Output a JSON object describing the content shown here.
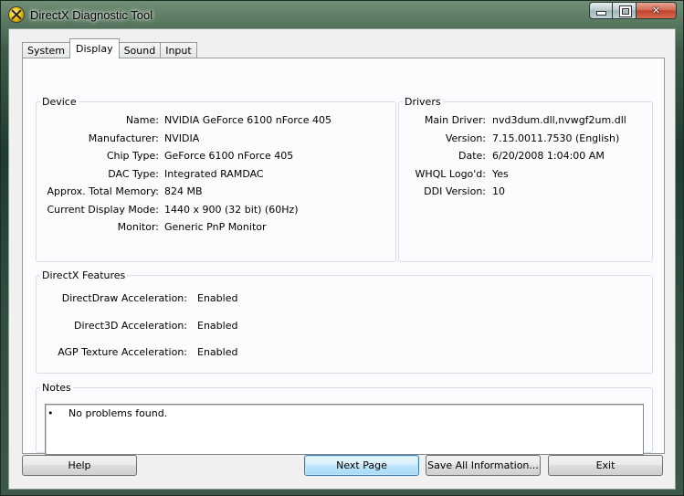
{
  "window": {
    "title": "DirectX Diagnostic Tool"
  },
  "tabs": [
    {
      "label": "System",
      "active": false
    },
    {
      "label": "Display",
      "active": true
    },
    {
      "label": "Sound",
      "active": false
    },
    {
      "label": "Input",
      "active": false
    }
  ],
  "device": {
    "legend": "Device",
    "fields": [
      {
        "label": "Name:",
        "value": "NVIDIA GeForce 6100 nForce 405"
      },
      {
        "label": "Manufacturer:",
        "value": "NVIDIA"
      },
      {
        "label": "Chip Type:",
        "value": "GeForce 6100 nForce 405"
      },
      {
        "label": "DAC Type:",
        "value": "Integrated RAMDAC"
      },
      {
        "label": "Approx. Total Memory:",
        "value": "824 MB"
      },
      {
        "label": "Current Display Mode:",
        "value": "1440 x 900 (32 bit) (60Hz)"
      },
      {
        "label": "Monitor:",
        "value": "Generic PnP Monitor"
      }
    ]
  },
  "drivers": {
    "legend": "Drivers",
    "fields": [
      {
        "label": "Main Driver:",
        "value": "nvd3dum.dll,nvwgf2um.dll"
      },
      {
        "label": "Version:",
        "value": "7.15.0011.7530 (English)"
      },
      {
        "label": "Date:",
        "value": "6/20/2008 1:04:00 AM"
      },
      {
        "label": "WHQL Logo'd:",
        "value": "Yes"
      },
      {
        "label": "DDI Version:",
        "value": "10"
      }
    ]
  },
  "features": {
    "legend": "DirectX Features",
    "fields": [
      {
        "label": "DirectDraw Acceleration:",
        "value": "Enabled"
      },
      {
        "label": "Direct3D Acceleration:",
        "value": "Enabled"
      },
      {
        "label": "AGP Texture Acceleration:",
        "value": "Enabled"
      }
    ]
  },
  "notes": {
    "legend": "Notes",
    "bullet": "•",
    "text": "No problems found."
  },
  "buttons": {
    "help": "Help",
    "next_page": "Next Page",
    "save_all": "Save All Information...",
    "exit": "Exit"
  }
}
